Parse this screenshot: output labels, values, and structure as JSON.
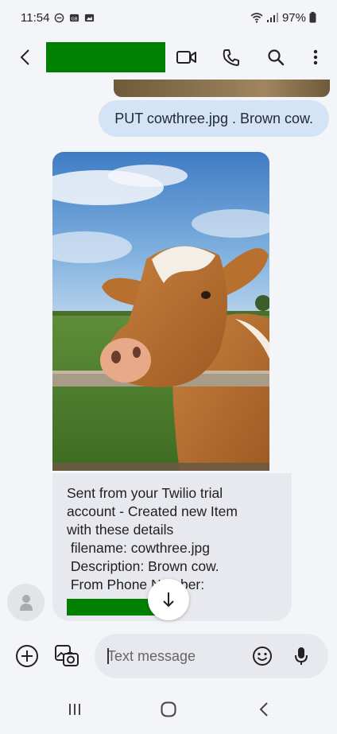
{
  "status_bar": {
    "time": "11:54",
    "battery": "97%"
  },
  "app_bar": {
    "contact_name_redacted": true,
    "icons": [
      "back-icon",
      "video-call-icon",
      "phone-icon",
      "search-icon",
      "more-options-icon"
    ]
  },
  "messages": {
    "outgoing_text": "PUT cowthree.jpg . Brown cow.",
    "incoming_image_subject": "cow",
    "incoming_lines": [
      "Sent from your Twilio trial",
      "account - Created new Item",
      "with these details",
      " filename: cowthree.jpg",
      " Description: Brown cow.",
      " From Phone Number:"
    ]
  },
  "composer": {
    "placeholder": "Text message"
  },
  "colors": {
    "background": "#f4f5f9",
    "outgoing_bubble": "#d4e3f5",
    "incoming_bubble": "#e8e9ee",
    "redaction": "#008000"
  }
}
